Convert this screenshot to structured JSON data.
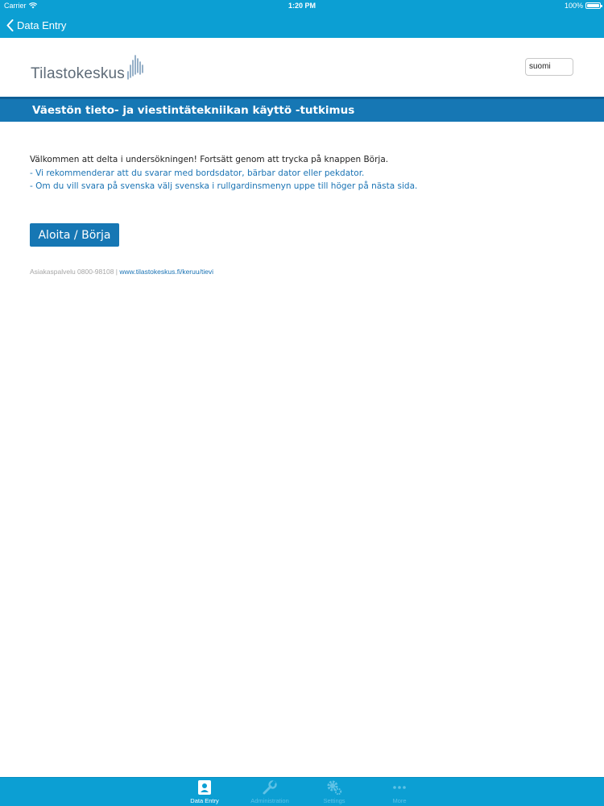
{
  "status_bar": {
    "carrier": "Carrier",
    "time": "1:20 PM",
    "battery": "100%"
  },
  "nav": {
    "back_label": "Data Entry"
  },
  "header": {
    "logo_text": "Tilastokeskus",
    "language_selected": "suomi"
  },
  "survey": {
    "title": "Väestön tieto- ja viestintätekniikan käyttö -tutkimus",
    "intro": "Välkommen att delta i undersökningen! Fortsätt genom att trycka på knappen Börja.",
    "note_1": "- Vi rekommenderar att du svarar med bordsdator, bärbar dator eller pekdator.",
    "note_2": "- Om du vill svara på svenska välj svenska i rullgardinsmenyn uppe till höger på nästa sida.",
    "start_button": "Aloita / Börja",
    "customer_service": "Asiakaspalvelu 0800-98108 |",
    "link": "www.tilastokeskus.fi/keruu/tievi"
  },
  "tabbar": {
    "tabs": [
      {
        "label": "Data Entry",
        "icon": "person-badge-icon",
        "active": true
      },
      {
        "label": "Administration",
        "icon": "wrench-icon",
        "active": false
      },
      {
        "label": "Settings",
        "icon": "gear-icon",
        "active": false
      },
      {
        "label": "More",
        "icon": "more-dots-icon",
        "active": false
      }
    ]
  },
  "colors": {
    "bar": "#0c9fd3",
    "title_band": "#1677b4",
    "link": "#1a73b4"
  }
}
